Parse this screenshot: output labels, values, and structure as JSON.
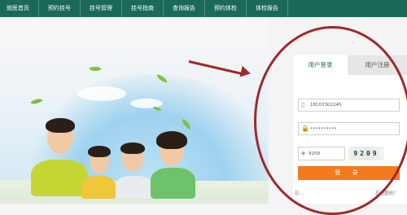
{
  "nav": {
    "items": [
      "就医首页",
      "预约挂号",
      "挂号管理",
      "挂号指南",
      "查询报告",
      "预约体检",
      "体检报告"
    ]
  },
  "login": {
    "tabs": {
      "login": "用户登录",
      "register": "用户注册"
    },
    "phone_value": "18103302245",
    "password_value": "••••••••••",
    "captcha_input": "9209",
    "captcha_code": "9209",
    "login_button": "登 录",
    "bottom_left": "忘...",
    "bottom_right": "忘记密码？"
  },
  "colors": {
    "nav_bg": "#1a6a57",
    "login_button": "#f47a1f",
    "annotation_red": "#9e2a2a"
  }
}
